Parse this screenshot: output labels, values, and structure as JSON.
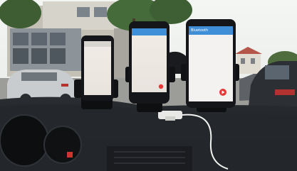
{
  "scene": {
    "description_colors": {
      "sky": "#eef1ef",
      "dashboard": "#1e2124",
      "phone_body": "#141619",
      "screen_bg": "#f3efea",
      "app_bar": "#3f8fd8",
      "fab": "#e53935",
      "mount": "#111214",
      "car_left": "#c9ccce",
      "car_right": "#2a2c30",
      "building": "#b9b6ad",
      "tree": "#3d5a34"
    }
  },
  "phones": [
    {
      "id": "left",
      "app_title": "",
      "has_fab": false
    },
    {
      "id": "center",
      "app_title": "",
      "has_fab": true
    },
    {
      "id": "right",
      "app_title": "Bluetooth",
      "has_fab": true
    }
  ]
}
